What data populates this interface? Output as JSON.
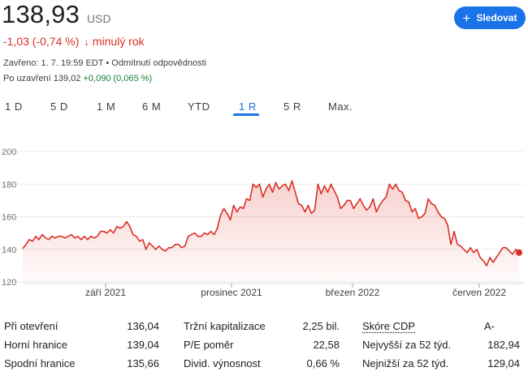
{
  "quote": {
    "price": "138,93",
    "currency": "USD",
    "change": "-1,03 (-0,74 %)",
    "change_arrow": "↓",
    "change_period": "minulý rok",
    "closed_text": "Zavřeno: 1. 7. 19:59 EDT",
    "bullet": " • ",
    "disclaimer_text": "Odmítnutí odpovědnosti",
    "after_hours_label": "Po uzavření",
    "after_hours_price": "139,02",
    "after_hours_change": "+0,090 (0,065 %)"
  },
  "follow_button": {
    "icon": "plus-icon",
    "label": "Sledovat"
  },
  "tabs": [
    {
      "label": "1 D"
    },
    {
      "label": "5 D"
    },
    {
      "label": "1 M"
    },
    {
      "label": "6 M"
    },
    {
      "label": "YTD"
    },
    {
      "label": "1 R"
    },
    {
      "label": "5 R"
    },
    {
      "label": "Max."
    }
  ],
  "active_tab": "1 R",
  "colors": {
    "line": "#d93025",
    "accent": "#1a73e8",
    "positive": "#188038",
    "negative": "#d93025"
  },
  "chart_data": {
    "type": "area",
    "ylim": [
      120,
      200
    ],
    "yticks": [
      120,
      140,
      160,
      180,
      200
    ],
    "xtick_labels": [
      "září 2021",
      "prosinec 2021",
      "březen 2022",
      "červen 2022"
    ],
    "grid": true,
    "series": [
      {
        "values": [
          140.5,
          143,
          146,
          145,
          148,
          146,
          149,
          147,
          146,
          148,
          147,
          148,
          148,
          147,
          148,
          149,
          147,
          148,
          146,
          148,
          146,
          148,
          147,
          148,
          151,
          151,
          150,
          152,
          150,
          154,
          153,
          154,
          157,
          154,
          149,
          148,
          145,
          146,
          140,
          144,
          142,
          140,
          142,
          140,
          139,
          141,
          141,
          143,
          143,
          141,
          142,
          148,
          149,
          150,
          148,
          148,
          150,
          149,
          151,
          149,
          153,
          161,
          165,
          162,
          158,
          167,
          163,
          166,
          165,
          171,
          170,
          180,
          178,
          180,
          172,
          177,
          180,
          175,
          181,
          177,
          179,
          180,
          176,
          182,
          175,
          168,
          167,
          163,
          167,
          162,
          164,
          180,
          174,
          179,
          175,
          180,
          176,
          172,
          165,
          167,
          170,
          170,
          165,
          168,
          171,
          167,
          164,
          166,
          171,
          163,
          167,
          170,
          172,
          180,
          177,
          180,
          176,
          175,
          170,
          169,
          163,
          165,
          159,
          160,
          162,
          171,
          168,
          167,
          163,
          160,
          159,
          155,
          143,
          151,
          143,
          142,
          140,
          138,
          141,
          138,
          140,
          135,
          133,
          130,
          135,
          132,
          135,
          138,
          141,
          141,
          139,
          137,
          140,
          138
        ]
      }
    ]
  },
  "stats": [
    {
      "label": "Při otevření",
      "value": "136,04"
    },
    {
      "label": "Horní hranice",
      "value": "139,04"
    },
    {
      "label": "Spodní hranice",
      "value": "135,66"
    },
    {
      "label": "Tržní kapitalizace",
      "value": "2,25 bil."
    },
    {
      "label": "P/E poměr",
      "value": "22,58"
    },
    {
      "label": "Divid. výnosnost",
      "value": "0,66 %"
    },
    {
      "label": "Skóre CDP",
      "value": "A-"
    },
    {
      "label": "Nejvyšší za 52 týd.",
      "value": "182,94"
    },
    {
      "label": "Nejnižší za 52 týd.",
      "value": "129,04"
    }
  ]
}
